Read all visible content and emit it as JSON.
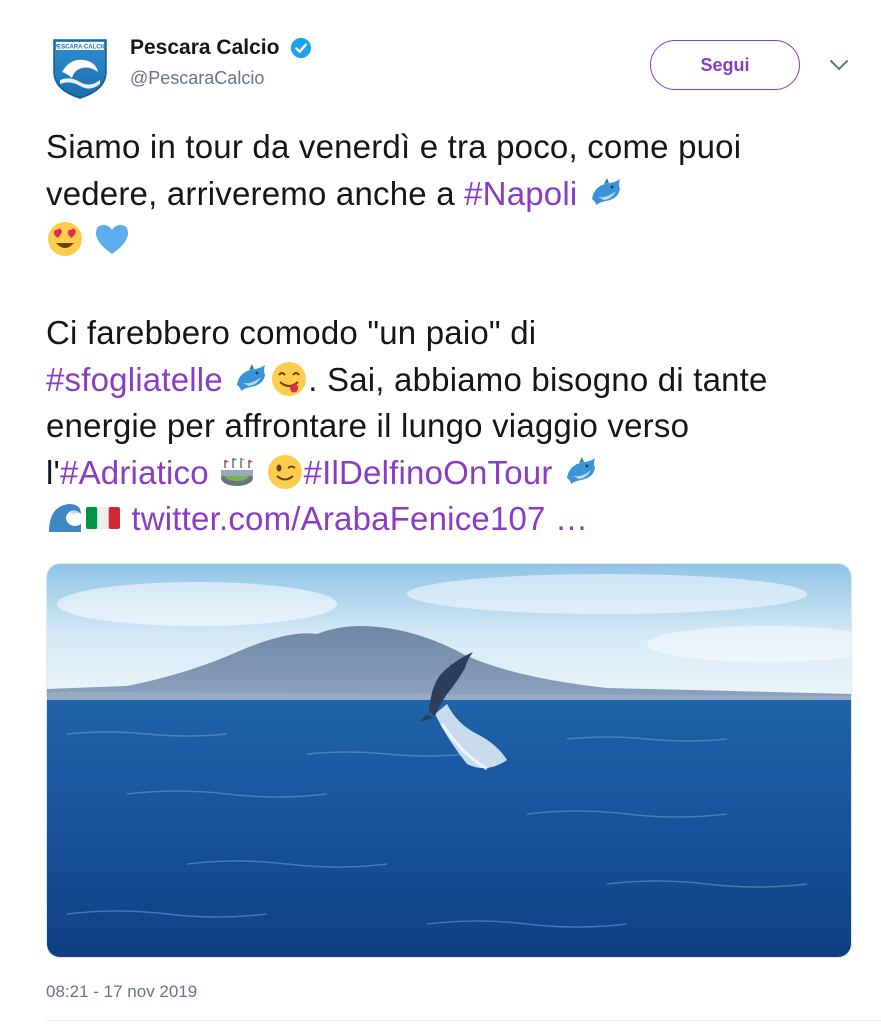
{
  "author": {
    "name": "Pescara Calcio",
    "handle": "@PescaraCalcio",
    "avatar_icon": "pescara-calcio-crest-icon",
    "verified_icon": "verified-badge-icon",
    "avatar_text": "PESCARA CALCIO"
  },
  "follow_button": {
    "label": "Segui"
  },
  "menu_icon": "chevron-down-icon",
  "tweet": {
    "line1_a": "Siamo in tour da venerdì e tra poco, come puoi vedere, arriveremo anche a ",
    "hashtag_napoli": "#Napoli",
    "line2_a": "Ci farebbero comodo \"un paio\" di ",
    "hashtag_sfogliatelle": "#sfogliatelle",
    "line2_b": ". Sai, abbiamo bisogno di tante energie per affrontare il lungo viaggio verso l'",
    "hashtag_adriatico": "#Adriatico",
    "hashtag_delfino": "#IlDelfinoOnTour",
    "link": "twitter.com/ArabaFenice107 …",
    "emojis": [
      "dolphin-emoji",
      "heart-eyes-emoji",
      "blue-heart-emoji",
      "savoring-food-emoji",
      "stadium-emoji",
      "winking-emoji",
      "water-wave-emoji",
      "italy-flag-emoji"
    ]
  },
  "media": {
    "icon": "dolphin-jumping-photo"
  },
  "timestamp": "08:21 - 17 nov 2019",
  "colors": {
    "accent": "#8b3cc4",
    "muted": "#657786",
    "verified": "#1da1f2"
  }
}
